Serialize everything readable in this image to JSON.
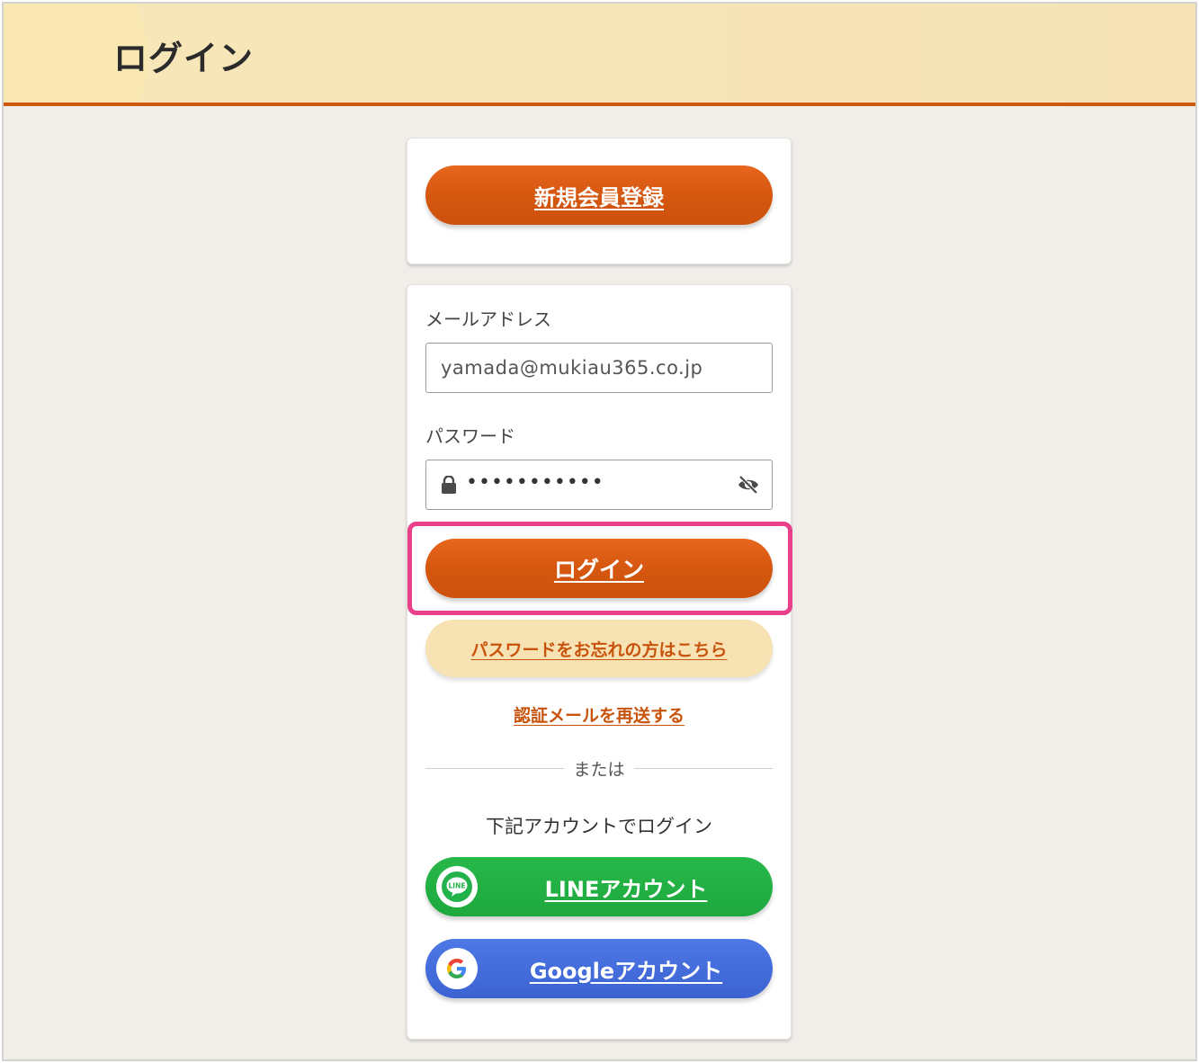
{
  "header": {
    "title": "ログイン"
  },
  "signup": {
    "label": "新規会員登録"
  },
  "login_form": {
    "email_label": "メールアドレス",
    "email_value": "yamada@mukiau365.co.jp",
    "password_label": "パスワード",
    "password_masked": "•••••••••••",
    "login_button": "ログイン",
    "forgot_password": "パスワードをお忘れの方はこちら",
    "resend_verification": "認証メールを再送する",
    "divider_text": "または",
    "social_title": "下記アカウントでログイン",
    "line_button": "LINEアカウント",
    "line_icon_text": "LINE",
    "google_button": "Googleアカウント"
  },
  "colors": {
    "accent_orange": "#d4560f",
    "highlight_pink": "#e8418a",
    "line_green": "#1ea83d",
    "google_blue": "#3c62d2"
  },
  "icons": {
    "lock": "lock-icon",
    "eye": "eye-off-icon",
    "line": "line-logo-icon",
    "google": "google-logo-icon"
  }
}
